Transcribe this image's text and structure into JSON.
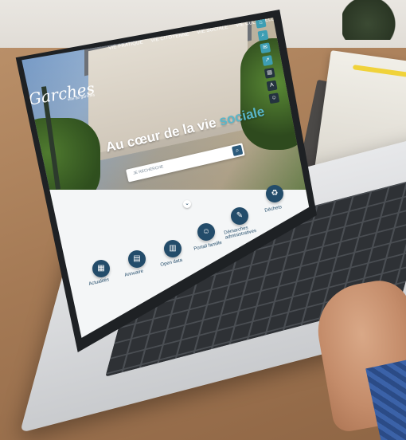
{
  "scene": {
    "description_tag": "photo"
  },
  "website": {
    "logo": {
      "name": "Garches",
      "subtitle": "ville de garches"
    },
    "nav": [
      "Vie pratique",
      "Vie citoyenne",
      "Vie sociale",
      "Vie culturelle & sportive"
    ],
    "tagline": {
      "prefix": "Au cœur de la vie",
      "accent": "sociale"
    },
    "search": {
      "placeholder": "Je recherche"
    },
    "quick_access": [
      {
        "label": "Actualités",
        "icon": "news-icon"
      },
      {
        "label": "Annuaire",
        "icon": "book-icon"
      },
      {
        "label": "Open data",
        "icon": "chart-icon"
      },
      {
        "label": "Portail famille",
        "icon": "family-icon"
      },
      {
        "label": "Démarches administratives",
        "icon": "document-icon"
      },
      {
        "label": "Déchets",
        "icon": "trash-icon"
      }
    ],
    "side_tools": [
      "home-icon",
      "search-icon",
      "contact-icon",
      "share-icon",
      "print-icon",
      "font-icon",
      "accessibility-icon"
    ]
  },
  "colors": {
    "brand_dark": "#234c6a",
    "accent": "#59b6c9",
    "laptop": "#c9cbce",
    "bezel": "#1e2124"
  }
}
